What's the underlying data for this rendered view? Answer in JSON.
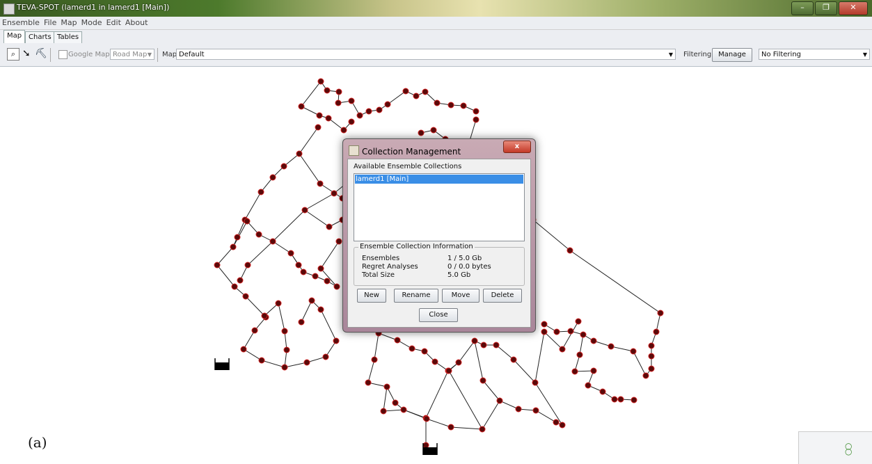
{
  "window": {
    "title": "TEVA-SPOT (lamerd1 in lamerd1 [Main])",
    "min_glyph": "–",
    "max_glyph": "❐",
    "close_glyph": "✕"
  },
  "menu": [
    "Ensemble",
    "File",
    "Map",
    "Mode",
    "Edit",
    "About"
  ],
  "tabs": [
    "Map",
    "Charts",
    "Tables"
  ],
  "toolbar": {
    "google_maps_label": "Google Maps",
    "road_map_value": "Road Map",
    "map_label": "Map",
    "map_select_value": "Default",
    "filtering_label": "Filtering",
    "manage_label": "Manage",
    "filter_select_value": "No Filtering"
  },
  "caption": "(a)",
  "dialog": {
    "title": "Collection Management",
    "close_glyph": "x",
    "available_label": "Available Ensemble Collections",
    "selected_collection": "lamerd1 [Main]",
    "info_legend": "Ensemble Collection Information",
    "info": [
      {
        "label": "Ensembles",
        "value": "1 / 5.0 Gb"
      },
      {
        "label": "Regret Analyses",
        "value": "0 / 0.0 bytes"
      },
      {
        "label": "Total Size",
        "value": "5.0 Gb"
      }
    ],
    "buttons": {
      "new": "New",
      "rename": "Rename",
      "move": "Move",
      "delete": "Delete",
      "close": "Close"
    }
  },
  "colors": {
    "node_fill": "#5a0a0a",
    "node_stroke": "#d02020",
    "link": "#222222",
    "selection": "#3a8ee6"
  }
}
